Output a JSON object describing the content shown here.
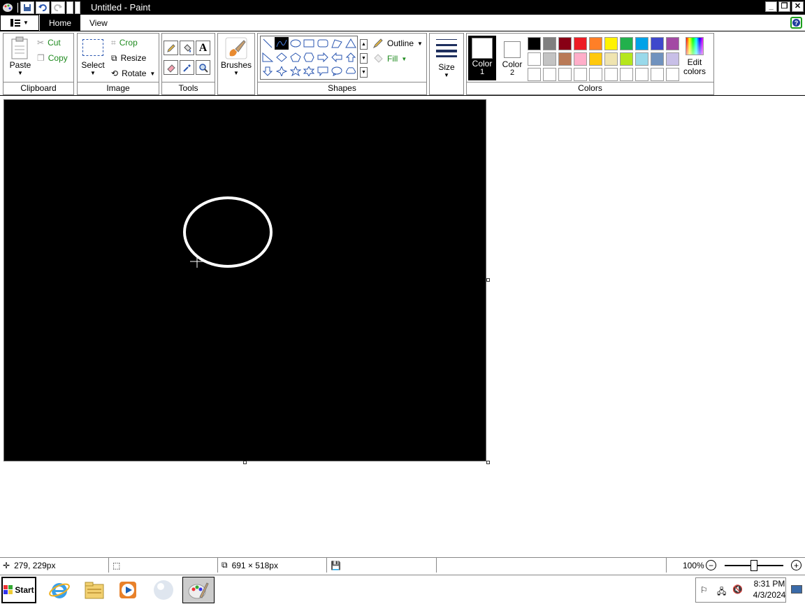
{
  "window": {
    "title": "Untitled - Paint"
  },
  "tabs": [
    {
      "label": "Home"
    },
    {
      "label": "View"
    }
  ],
  "clipboard": {
    "paste": "Paste",
    "cut": "Cut",
    "copy": "Copy",
    "group": "Clipboard"
  },
  "image": {
    "select": "Select",
    "crop": "Crop",
    "resize": "Resize",
    "rotate": "Rotate",
    "group": "Image"
  },
  "tools": {
    "group": "Tools"
  },
  "brushes": {
    "label": "Brushes"
  },
  "shapes": {
    "outline": "Outline",
    "fill": "Fill",
    "group": "Shapes"
  },
  "size": {
    "label": "Size"
  },
  "colors": {
    "color1": "Color",
    "color1_num": "1",
    "color2": "Color",
    "color2_num": "2",
    "edit1": "Edit",
    "edit2": "colors",
    "group": "Colors",
    "palette_row1": [
      "#000000",
      "#7f7f7f",
      "#880015",
      "#ed1c24",
      "#ff7f27",
      "#fff200",
      "#22b14c",
      "#00a2e8",
      "#3f48cc",
      "#a349a4"
    ],
    "palette_row2": [
      "#ffffff",
      "#c3c3c3",
      "#b97a57",
      "#ffaec9",
      "#ffc90e",
      "#efe4b0",
      "#b5e61d",
      "#99d9ea",
      "#7092be",
      "#c8bfe7"
    ],
    "palette_row3": [
      "#ffffff",
      "#ffffff",
      "#ffffff",
      "#ffffff",
      "#ffffff",
      "#ffffff",
      "#ffffff",
      "#ffffff",
      "#ffffff",
      "#ffffff"
    ]
  },
  "status": {
    "cursor_pos": "279, 229px",
    "canvas_size": "691 × 518px",
    "zoom": "100%"
  },
  "taskbar": {
    "start": "Start",
    "time": "8:31 PM",
    "date": "4/3/2024"
  }
}
